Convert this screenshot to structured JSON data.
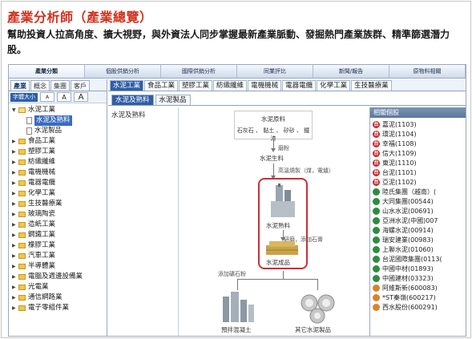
{
  "heading": "產業分析師（產業總覽）",
  "description": "幫助投資人拉高角度、擴大視野，與外資法人同步掌握最新產業脈動、發掘熱門產業族群、精準篩選潛力股。",
  "top_nav": [
    "產業分類",
    "個股供銷分析",
    "國際供銷分析",
    "同業評比",
    "新聞/報告",
    "原物料相關"
  ],
  "left_tabs": [
    "產業",
    "概念",
    "集團",
    "客戶"
  ],
  "font_bar": {
    "label": "字體大小",
    "small": "A",
    "medium": "A",
    "large": "A"
  },
  "tree": [
    {
      "label": "水泥工業",
      "open": true,
      "children": [
        {
          "label": "水泥及熟料",
          "selected": true
        },
        {
          "label": "水泥製品",
          "selected": false
        }
      ]
    },
    {
      "label": "食品工業"
    },
    {
      "label": "塑膠工業"
    },
    {
      "label": "紡織纖維"
    },
    {
      "label": "電機機械"
    },
    {
      "label": "電器電纜"
    },
    {
      "label": "化學工業"
    },
    {
      "label": "生技醫療業"
    },
    {
      "label": "玻璃陶瓷"
    },
    {
      "label": "造紙工業"
    },
    {
      "label": "鋼鐵工業"
    },
    {
      "label": "橡膠工業"
    },
    {
      "label": "汽車工業"
    },
    {
      "label": "半導體業"
    },
    {
      "label": "電腦及週邊設備業"
    },
    {
      "label": "光電業"
    },
    {
      "label": "通信網路業"
    },
    {
      "label": "電子零組件業"
    }
  ],
  "industry_tabs": [
    "水泥工業",
    "食品工業",
    "塑膠工業",
    "紡織纖維",
    "電機機械",
    "電器電纜",
    "化學工業",
    "生技醫療業"
  ],
  "sub_tabs": [
    "水泥及熟料",
    "水泥製品"
  ],
  "middle_list": [
    "水泥及熟料"
  ],
  "diagram": {
    "raw_title": "水泥原料",
    "raw_items": "石灰石 、 黏土 、 矽砂 、 鐵渣",
    "step1": "磨粉",
    "intermediate": "水泥生料",
    "step2": "高溫燒製（煤，電爐）",
    "clinker": "水泥熟料",
    "step3": "研磨，添加石膏",
    "product": "水泥成品",
    "step4": "添加礦石粉",
    "out1": "預拌混凝土",
    "out2": "其它水泥製品"
  },
  "right_panel": {
    "title": "相關個股",
    "stocks": [
      {
        "label": "嘉泥(1103)",
        "dot": "red"
      },
      {
        "label": "環泥(1104)",
        "dot": "red"
      },
      {
        "label": "幸福(1108)",
        "dot": "red"
      },
      {
        "label": "信大(1109)",
        "dot": "red"
      },
      {
        "label": "東泥(1110)",
        "dot": "red"
      },
      {
        "label": "台泥(1101)",
        "dot": "red"
      },
      {
        "label": "亞泥(1102)",
        "dot": "red"
      },
      {
        "label": "陸氏集團（越南）(",
        "dot": "green"
      },
      {
        "label": "大同集團(00544)",
        "dot": "green"
      },
      {
        "label": "山水水泥(00691)",
        "dot": "green"
      },
      {
        "label": "亞洲水泥(中國)007",
        "dot": "green"
      },
      {
        "label": "海螺水泥(00914)",
        "dot": "green"
      },
      {
        "label": "瑞安建業(00983)",
        "dot": "green"
      },
      {
        "label": "上聯水泥(01060)",
        "dot": "green"
      },
      {
        "label": "台泥國際集團(0113(",
        "dot": "green"
      },
      {
        "label": "中國中材(01893)",
        "dot": "green"
      },
      {
        "label": "中國建材(03323)",
        "dot": "green"
      },
      {
        "label": "阿維斯新(600083)",
        "dot": "orange"
      },
      {
        "label": "*ST秦嶺(600217)",
        "dot": "orange"
      },
      {
        "label": "西水股份(600291)",
        "dot": "orange"
      }
    ]
  },
  "colors": {
    "heading": "#d2321e",
    "accent_blue": "#2e5ea6",
    "highlight_red": "#cf2d36"
  }
}
